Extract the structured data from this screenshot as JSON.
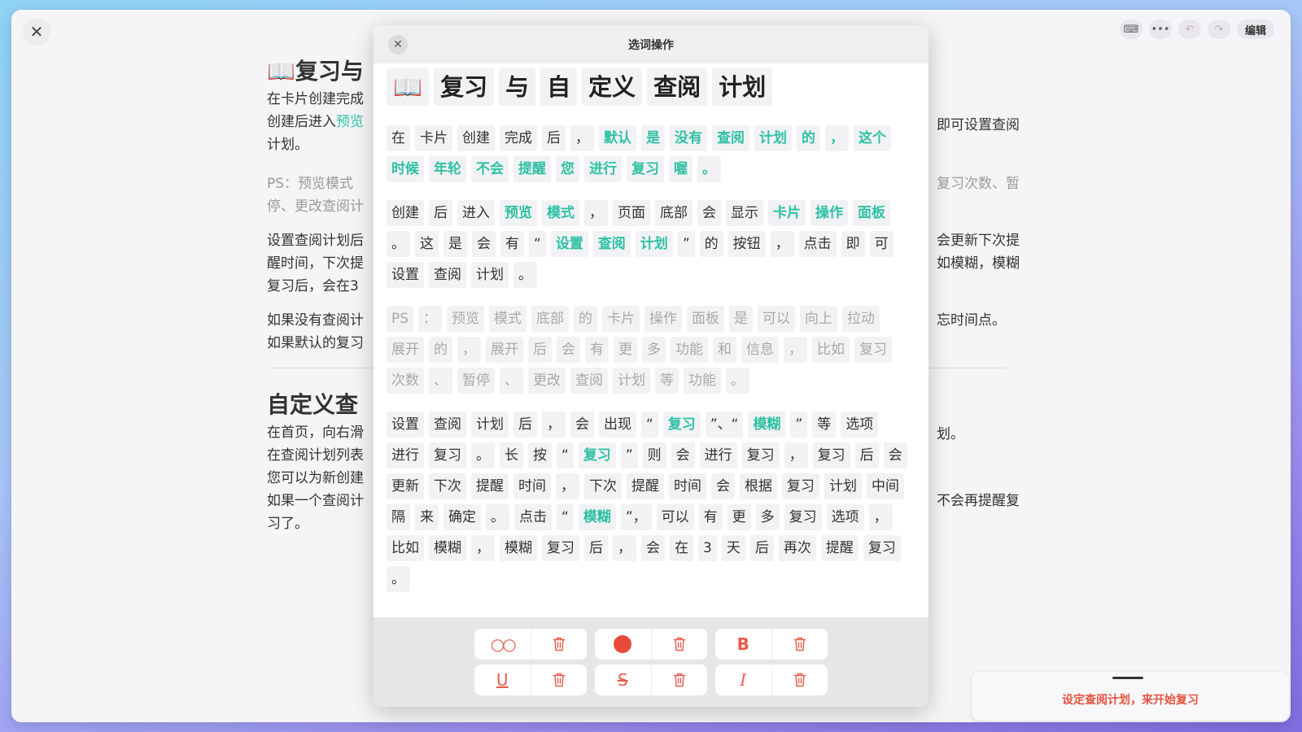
{
  "toolbar": {
    "edit_label": "编辑"
  },
  "doc": {
    "h1_visible": "复习与",
    "line1": "在卡片创建完成",
    "line2_a": "创建后进入",
    "line2_b": "预览",
    "line3": "计划。",
    "ps1": "PS：预览模式",
    "ps2": "停、更改查阅计",
    "p3_1": "设置查阅计划后",
    "p3_2": "醒时间，下次提",
    "p3_3": "复习后，会在3",
    "p4_1": "如果没有查阅计",
    "p4_2": "如果默认的复习",
    "h2_visible": "自定义查",
    "p5_1": "在首页，向右滑",
    "p5_2": "在查阅计划列表",
    "p5_3": "您可以为新创建",
    "p5_4": "如果一个查阅计",
    "p5_5": "习了。"
  },
  "right_frags": {
    "r1": "即可设置查阅",
    "r2": "复习次数、暂",
    "r3": "会更新下次提",
    "r4": "如模糊，模糊",
    "r5": "忘时间点。",
    "r6": "划。",
    "r7": "不会再提醒复"
  },
  "modal": {
    "title": "选词操作",
    "paragraphs": [
      {
        "kind": "title",
        "tokens": [
          {
            "t": "📖"
          },
          {
            "t": "复习"
          },
          {
            "t": "与"
          },
          {
            "t": "自"
          },
          {
            "t": "定义"
          },
          {
            "t": "查阅"
          },
          {
            "t": "计划"
          }
        ]
      },
      {
        "kind": "body",
        "tokens": [
          {
            "t": "在"
          },
          {
            "t": "卡片"
          },
          {
            "t": "创建"
          },
          {
            "t": "完成"
          },
          {
            "t": "后"
          },
          {
            "t": "，"
          },
          {
            "t": "默认",
            "h": 1
          },
          {
            "t": "是",
            "h": 1
          },
          {
            "t": "没有",
            "h": 1
          },
          {
            "t": "查阅",
            "h": 1
          },
          {
            "t": "计划",
            "h": 1
          },
          {
            "t": "的",
            "h": 1
          },
          {
            "t": "，",
            "h": 1
          },
          {
            "t": "这个",
            "h": 1
          },
          {
            "t": "时候",
            "h": 1
          },
          {
            "t": "年轮",
            "h": 1
          },
          {
            "t": "不会",
            "h": 1
          },
          {
            "t": "提醒",
            "h": 1
          },
          {
            "t": "您",
            "h": 1
          },
          {
            "t": "进行",
            "h": 1
          },
          {
            "t": "复习",
            "h": 1
          },
          {
            "t": "喔",
            "h": 1
          },
          {
            "t": "。",
            "h": 1
          }
        ]
      },
      {
        "kind": "body",
        "tokens": [
          {
            "t": "创建"
          },
          {
            "t": "后"
          },
          {
            "t": "进入"
          },
          {
            "t": "预览",
            "h": 1
          },
          {
            "t": "模式",
            "h": 1
          },
          {
            "t": "，"
          },
          {
            "t": "页面"
          },
          {
            "t": "底部"
          },
          {
            "t": "会"
          },
          {
            "t": "显示"
          },
          {
            "t": "卡片",
            "h": 1
          },
          {
            "t": "操作",
            "h": 1
          },
          {
            "t": "面板",
            "h": 1
          },
          {
            "t": "。"
          },
          {
            "t": "这"
          },
          {
            "t": "是"
          },
          {
            "t": "会"
          },
          {
            "t": "有"
          },
          {
            "t": "“"
          },
          {
            "t": "设置",
            "h": 1
          },
          {
            "t": "查阅",
            "h": 1
          },
          {
            "t": "计划",
            "h": 1
          },
          {
            "t": "”"
          },
          {
            "t": "的"
          },
          {
            "t": "按钮"
          },
          {
            "t": "，"
          },
          {
            "t": "点击"
          },
          {
            "t": "即"
          },
          {
            "t": "可"
          },
          {
            "t": "设置"
          },
          {
            "t": "查阅"
          },
          {
            "t": "计划"
          },
          {
            "t": "。"
          }
        ]
      },
      {
        "kind": "ps",
        "tokens": [
          {
            "t": "PS"
          },
          {
            "t": "："
          },
          {
            "t": "预览"
          },
          {
            "t": "模式"
          },
          {
            "t": "底部"
          },
          {
            "t": "的"
          },
          {
            "t": "卡片"
          },
          {
            "t": "操作"
          },
          {
            "t": "面板"
          },
          {
            "t": "是"
          },
          {
            "t": "可以"
          },
          {
            "t": "向上"
          },
          {
            "t": "拉动"
          },
          {
            "t": "展开"
          },
          {
            "t": "的"
          },
          {
            "t": "，"
          },
          {
            "t": "展开"
          },
          {
            "t": "后"
          },
          {
            "t": "会"
          },
          {
            "t": "有"
          },
          {
            "t": "更"
          },
          {
            "t": "多"
          },
          {
            "t": "功能"
          },
          {
            "t": "和"
          },
          {
            "t": "信息"
          },
          {
            "t": "，"
          },
          {
            "t": "比如"
          },
          {
            "t": "复习"
          },
          {
            "t": "次数"
          },
          {
            "t": "、"
          },
          {
            "t": "暂停"
          },
          {
            "t": "、"
          },
          {
            "t": "更改"
          },
          {
            "t": "查阅"
          },
          {
            "t": "计划"
          },
          {
            "t": "等"
          },
          {
            "t": "功能"
          },
          {
            "t": "。"
          }
        ]
      },
      {
        "kind": "body",
        "tokens": [
          {
            "t": "设置"
          },
          {
            "t": "查阅"
          },
          {
            "t": "计划"
          },
          {
            "t": "后"
          },
          {
            "t": "，"
          },
          {
            "t": "会"
          },
          {
            "t": "出现"
          },
          {
            "t": "“"
          },
          {
            "t": "复习",
            "h": 1
          },
          {
            "t": "”、“"
          },
          {
            "t": "模糊",
            "h": 1
          },
          {
            "t": "”"
          },
          {
            "t": "等"
          },
          {
            "t": "选项"
          },
          {
            "t": "进行"
          },
          {
            "t": "复习"
          },
          {
            "t": "。"
          },
          {
            "t": "长"
          },
          {
            "t": "按"
          },
          {
            "t": "“"
          },
          {
            "t": "复习",
            "h": 1
          },
          {
            "t": "”"
          },
          {
            "t": "则"
          },
          {
            "t": "会"
          },
          {
            "t": "进行"
          },
          {
            "t": "复习"
          },
          {
            "t": "，"
          },
          {
            "t": "复习"
          },
          {
            "t": "后"
          },
          {
            "t": "会"
          },
          {
            "t": "更新"
          },
          {
            "t": "下次"
          },
          {
            "t": "提醒"
          },
          {
            "t": "时间"
          },
          {
            "t": "，"
          },
          {
            "t": "下次"
          },
          {
            "t": "提醒"
          },
          {
            "t": "时间"
          },
          {
            "t": "会"
          },
          {
            "t": "根据"
          },
          {
            "t": "复习"
          },
          {
            "t": "计划"
          },
          {
            "t": "中间"
          },
          {
            "t": "隔"
          },
          {
            "t": "来"
          },
          {
            "t": "确定"
          },
          {
            "t": "。"
          },
          {
            "t": "点击"
          },
          {
            "t": "“"
          },
          {
            "t": "模糊",
            "h": 1
          },
          {
            "t": "”，"
          },
          {
            "t": "可以"
          },
          {
            "t": "有"
          },
          {
            "t": "更"
          },
          {
            "t": "多"
          },
          {
            "t": "复习"
          },
          {
            "t": "选项"
          },
          {
            "t": "，"
          },
          {
            "t": "比如"
          },
          {
            "t": "模糊"
          },
          {
            "t": "，"
          },
          {
            "t": "模糊"
          },
          {
            "t": "复习"
          },
          {
            "t": "后"
          },
          {
            "t": "，"
          },
          {
            "t": "会"
          },
          {
            "t": "在"
          },
          {
            "t": "3"
          },
          {
            "t": "天"
          },
          {
            "t": "后"
          },
          {
            "t": "再次"
          },
          {
            "t": "提醒"
          },
          {
            "t": "复习"
          },
          {
            "t": "。"
          }
        ]
      }
    ]
  },
  "actions": {
    "bold_glyph": "B",
    "underline_glyph": "U",
    "strike_glyph": "S",
    "italic_glyph": "I",
    "glasses_glyph": "○○",
    "accent_color": "#e85a4a"
  },
  "bottom_panel": {
    "text": "设定查阅计划，来开始复习"
  },
  "colors": {
    "highlight": "#2fc1a4",
    "accent": "#e4533f"
  }
}
